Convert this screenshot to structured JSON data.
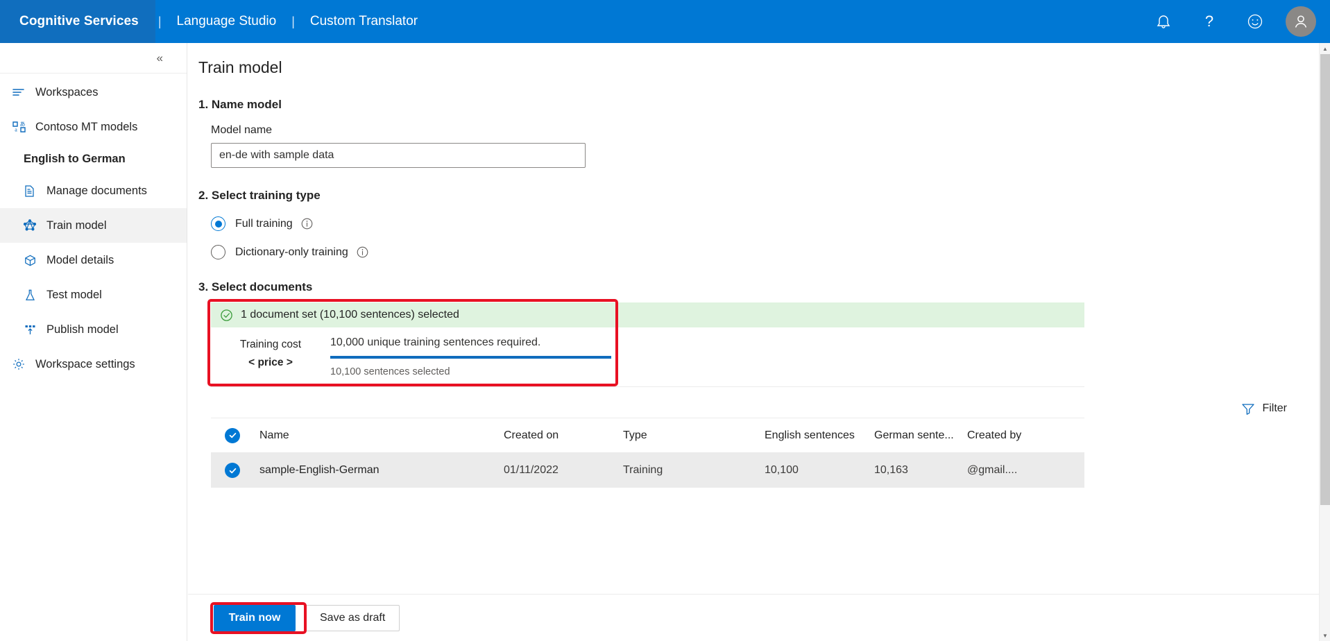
{
  "topbar": {
    "brand": "Cognitive Services",
    "separator": "|",
    "links": [
      {
        "label": "Language Studio"
      },
      {
        "label": "Custom Translator"
      }
    ],
    "icons": [
      {
        "name": "bell-icon",
        "label": "Notifications"
      },
      {
        "name": "help-icon",
        "label": "Help"
      },
      {
        "name": "feedback-icon",
        "label": "Feedback"
      },
      {
        "name": "account-avatar",
        "label": "Account"
      }
    ],
    "background_color": "#0078d4",
    "brand_chip_color": "#106ebe"
  },
  "sidebar": {
    "collapse_glyph": "«",
    "items": [
      {
        "label": "Workspaces",
        "icon": "workspaces-icon",
        "level": 1,
        "selected": false
      },
      {
        "label": "Contoso MT models",
        "icon": "models-icon",
        "level": 1,
        "selected": false
      },
      {
        "label": "English to German",
        "icon": "",
        "level": 0,
        "selected": false,
        "group": true
      },
      {
        "label": "Manage documents",
        "icon": "document-icon",
        "level": 2,
        "selected": false
      },
      {
        "label": "Train model",
        "icon": "train-icon",
        "level": 2,
        "selected": true
      },
      {
        "label": "Model details",
        "icon": "box-icon",
        "level": 2,
        "selected": false
      },
      {
        "label": "Test model",
        "icon": "flask-icon",
        "level": 2,
        "selected": false
      },
      {
        "label": "Publish model",
        "icon": "publish-icon",
        "level": 2,
        "selected": false
      },
      {
        "label": "Workspace settings",
        "icon": "gear-icon",
        "level": 1,
        "selected": false
      }
    ]
  },
  "main": {
    "page_title": "Train model",
    "step1": {
      "heading": "1. Name model",
      "field_label": "Model name",
      "model_name_value": "en-de with sample data",
      "model_name_placeholder": "Enter model name"
    },
    "step2": {
      "heading": "2. Select training type",
      "options": [
        {
          "label": "Full training",
          "selected": true,
          "info": "i"
        },
        {
          "label": "Dictionary-only training",
          "selected": false,
          "info": "i"
        }
      ]
    },
    "step3": {
      "heading": "3. Select documents",
      "summary_banner": "1 document set (10,100 sentences) selected",
      "cost_title": "Training cost",
      "cost_price": "< price >",
      "requirement_text": "10,000 unique training sentences required.",
      "selected_text": "10,100 sentences selected",
      "progress_percent": 100,
      "filter_label": "Filter"
    },
    "table": {
      "columns": [
        "Name",
        "Created on",
        "Type",
        "English sentences",
        "German sente...",
        "Created by"
      ],
      "rows": [
        {
          "selected": true,
          "name": "sample-English-German",
          "created_on": "01/11/2022",
          "type": "Training",
          "english_sentences": "10,100",
          "german_sentences": "10,163",
          "created_by": "@gmail...."
        }
      ]
    },
    "footer": {
      "primary_label": "Train now",
      "secondary_label": "Save as draft"
    }
  },
  "colors": {
    "accent": "#0078d4",
    "banner_green": "#dff3df",
    "annotation_red": "#e81123",
    "progress_blue": "#0f6cbd"
  }
}
